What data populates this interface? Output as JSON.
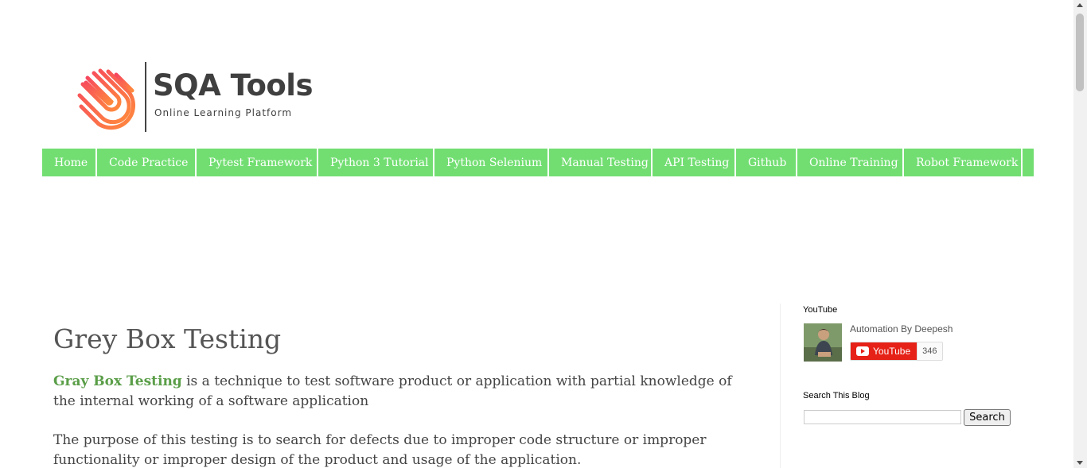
{
  "header": {
    "logo_title": "SQA Tools",
    "logo_subtitle": "Online Learning Platform",
    "logo_icon": "fingerprint-logo-icon",
    "brand_gradient": [
      "#f6465f",
      "#ff8a3d"
    ]
  },
  "nav": {
    "background": "#72de72",
    "items": [
      {
        "label": "Home"
      },
      {
        "label": "Code Practice"
      },
      {
        "label": "Pytest Framework"
      },
      {
        "label": "Python 3 Tutorial"
      },
      {
        "label": "Python Selenium"
      },
      {
        "label": "Manual Testing"
      },
      {
        "label": "API Testing"
      },
      {
        "label": "Github"
      },
      {
        "label": "Online Training"
      },
      {
        "label": "Robot Framework"
      }
    ]
  },
  "post": {
    "title": "Grey Box Testing",
    "para1_highlight": "Gray Box Testing",
    "para1_rest": " is a technique to test software product or application with partial knowledge of the internal working of a software application",
    "para2": "The purpose of this testing is to search for defects due to improper code structure or improper functionality or improper design of the product and usage of the application.",
    "highlight_color": "#5a9e48"
  },
  "sidebar": {
    "youtube": {
      "heading": "YouTube",
      "channel_name": "Automation By Deepesh",
      "button_label": "YouTube",
      "subscriber_count": "346",
      "button_color": "#e62117"
    },
    "search": {
      "heading": "Search This Blog",
      "input_value": "",
      "button_label": "Search"
    }
  }
}
